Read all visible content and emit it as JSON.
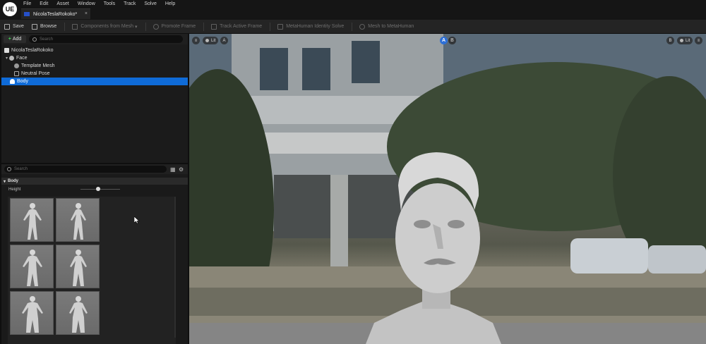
{
  "app": {
    "logo": "UE",
    "tab_title": "NicolaTeslaRokoko*",
    "tab_close": "×"
  },
  "menu": [
    "File",
    "Edit",
    "Asset",
    "Window",
    "Tools",
    "Track",
    "Solve",
    "Help"
  ],
  "toolbar": {
    "save": "Save",
    "browse": "Browse",
    "components_from_mesh": "Components from Mesh",
    "promote_frame": "Promote Frame",
    "track_active_frame": "Track Active Frame",
    "metahuman_identity_solve": "MetaHuman Identity Solve",
    "mesh_to_metahuman": "Mesh to MetaHuman"
  },
  "outliner": {
    "add_label": "Add",
    "search_placeholder": "Search",
    "items": [
      "NicolaTeslaRokoko",
      "Face",
      "Template Mesh",
      "Neutral Pose",
      "Body"
    ]
  },
  "body_panel": {
    "search_placeholder": "Search",
    "category": "Body",
    "height_label": "Height",
    "height_value": 0.45
  },
  "viewport": {
    "left_lit": "Lit",
    "left_view": "A",
    "ab_a": "A",
    "ab_b": "B",
    "right_view": "B",
    "right_lit": "Lit"
  },
  "colors": {
    "accent": "#0f6bd8",
    "selection": "#2d6fd6",
    "add_plus": "#44cc55",
    "tab_icon": "#2650c8"
  }
}
